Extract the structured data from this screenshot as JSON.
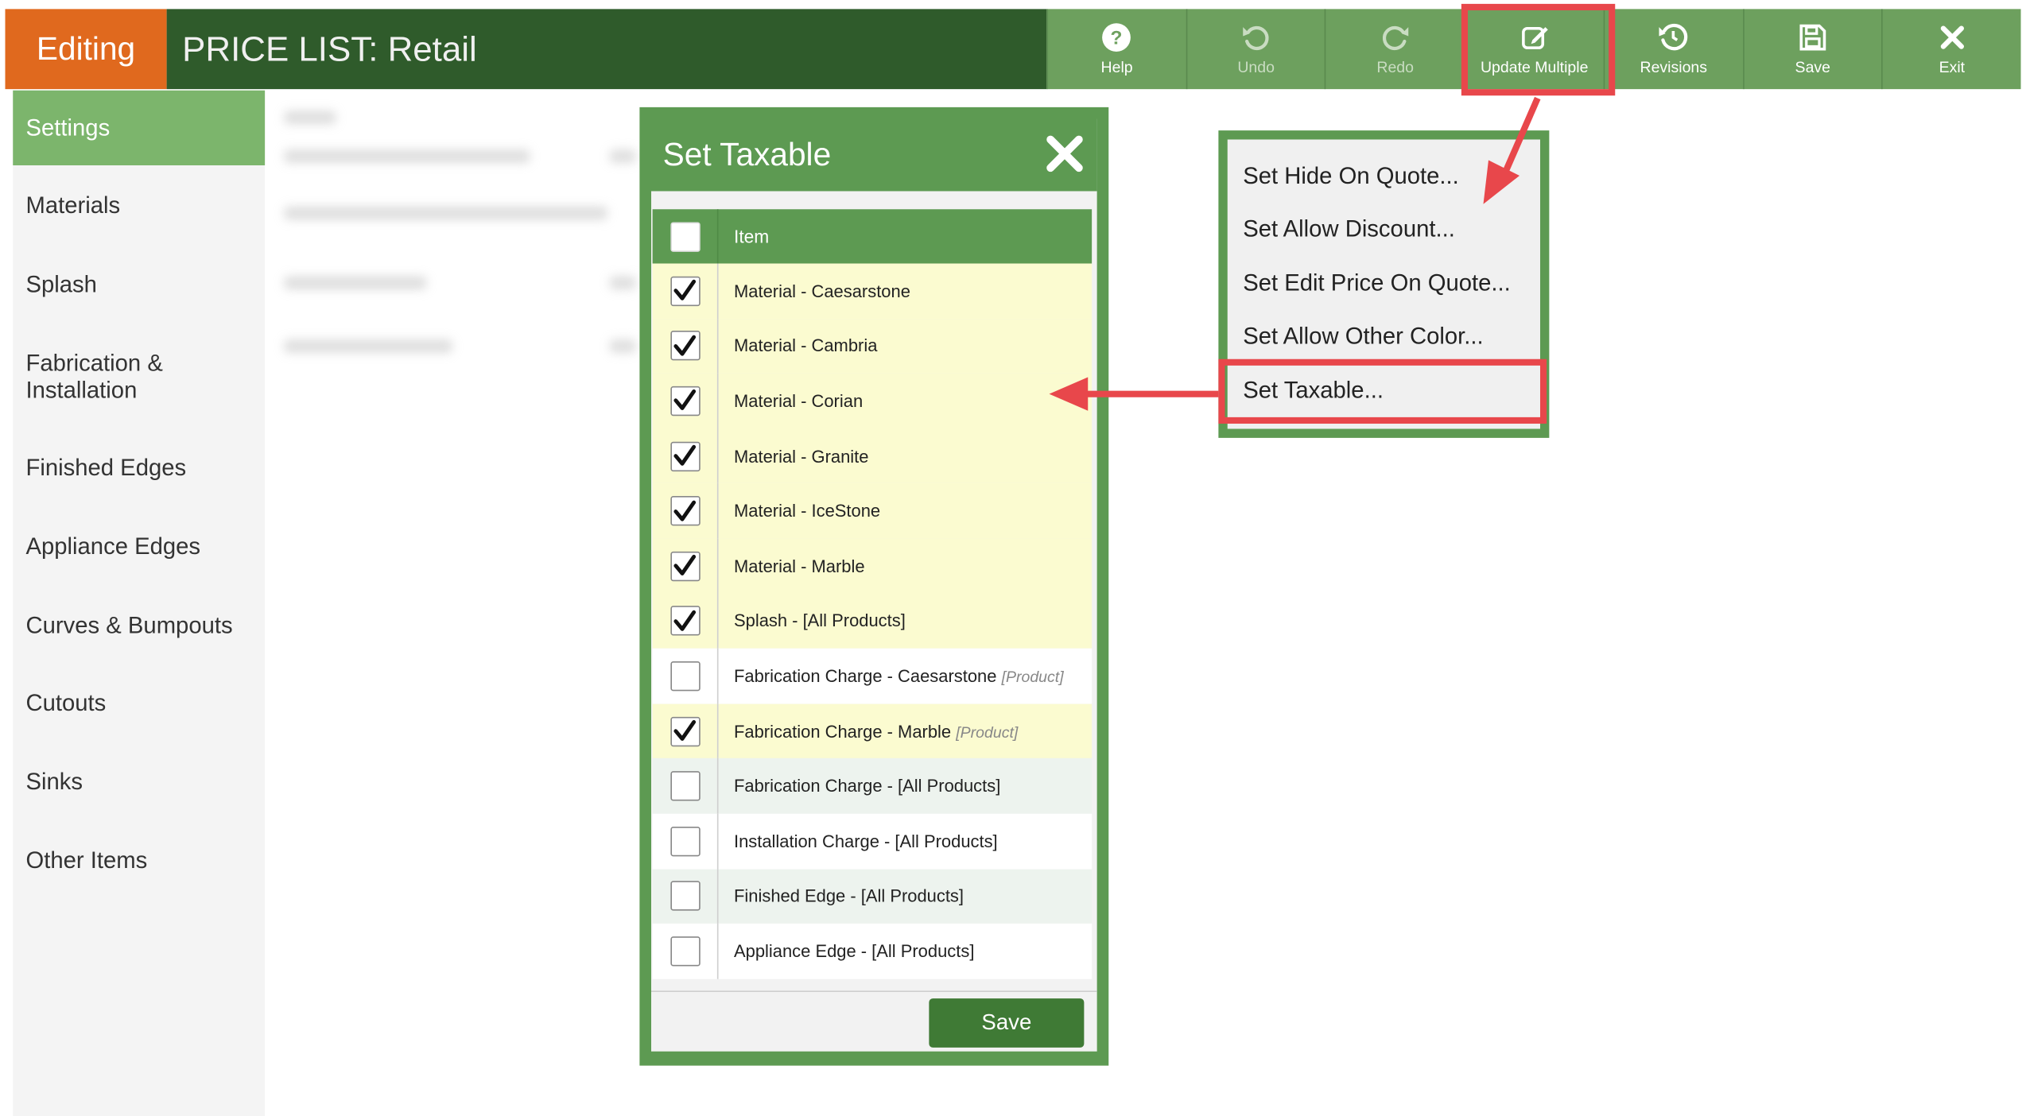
{
  "header": {
    "mode_label": "Editing",
    "title": "PRICE LIST:  Retail"
  },
  "toolbar": {
    "buttons": [
      {
        "label": "Help",
        "icon": "help-circle-icon"
      },
      {
        "label": "Undo",
        "icon": "undo-icon"
      },
      {
        "label": "Redo",
        "icon": "redo-icon"
      },
      {
        "label": "Update Multiple",
        "icon": "edit-icon"
      },
      {
        "label": "Revisions",
        "icon": "history-icon"
      },
      {
        "label": "Save",
        "icon": "floppy-disk-icon"
      },
      {
        "label": "Exit",
        "icon": "close-icon"
      }
    ]
  },
  "sidebar": {
    "items": [
      {
        "label": "Settings",
        "active": true
      },
      {
        "label": "Materials"
      },
      {
        "label": "Splash"
      },
      {
        "label": "Fabrication & Installation"
      },
      {
        "label": "Finished Edges"
      },
      {
        "label": "Appliance Edges"
      },
      {
        "label": "Curves & Bumpouts"
      },
      {
        "label": "Cutouts"
      },
      {
        "label": "Sinks"
      },
      {
        "label": "Other Items"
      }
    ]
  },
  "dialog": {
    "title": "Set Taxable",
    "column_header": "Item",
    "header_checked": false,
    "rows": [
      {
        "label": "Material - Caesarstone",
        "tag": "",
        "checked": true
      },
      {
        "label": "Material - Cambria",
        "tag": "",
        "checked": true
      },
      {
        "label": "Material - Corian",
        "tag": "",
        "checked": true
      },
      {
        "label": "Material - Granite",
        "tag": "",
        "checked": true
      },
      {
        "label": "Material - IceStone",
        "tag": "",
        "checked": true
      },
      {
        "label": "Material - Marble",
        "tag": "",
        "checked": true
      },
      {
        "label": "Splash - [All Products]",
        "tag": "",
        "checked": true
      },
      {
        "label": "Fabrication Charge - Caesarstone",
        "tag": "[Product]",
        "checked": false
      },
      {
        "label": "Fabrication Charge - Marble",
        "tag": "[Product]",
        "checked": true
      },
      {
        "label": "Fabrication Charge - [All Products]",
        "tag": "",
        "checked": false
      },
      {
        "label": "Installation Charge - [All Products]",
        "tag": "",
        "checked": false
      },
      {
        "label": "Finished Edge - [All Products]",
        "tag": "",
        "checked": false
      },
      {
        "label": "Appliance Edge - [All Products]",
        "tag": "",
        "checked": false
      }
    ],
    "save_label": "Save"
  },
  "menu": {
    "items": [
      "Set Hide On Quote...",
      "Set Allow Discount...",
      "Set Edit Price On Quote...",
      "Set Allow Other Color...",
      "Set Taxable..."
    ]
  },
  "colors": {
    "editing_orange": "#e0691e",
    "title_green": "#2f5b2b",
    "toolbar_green": "#6da05e",
    "dialog_green": "#5d9a52",
    "highlight_red": "#e8474b",
    "checked_row_yellow": "#fbfbd0"
  }
}
